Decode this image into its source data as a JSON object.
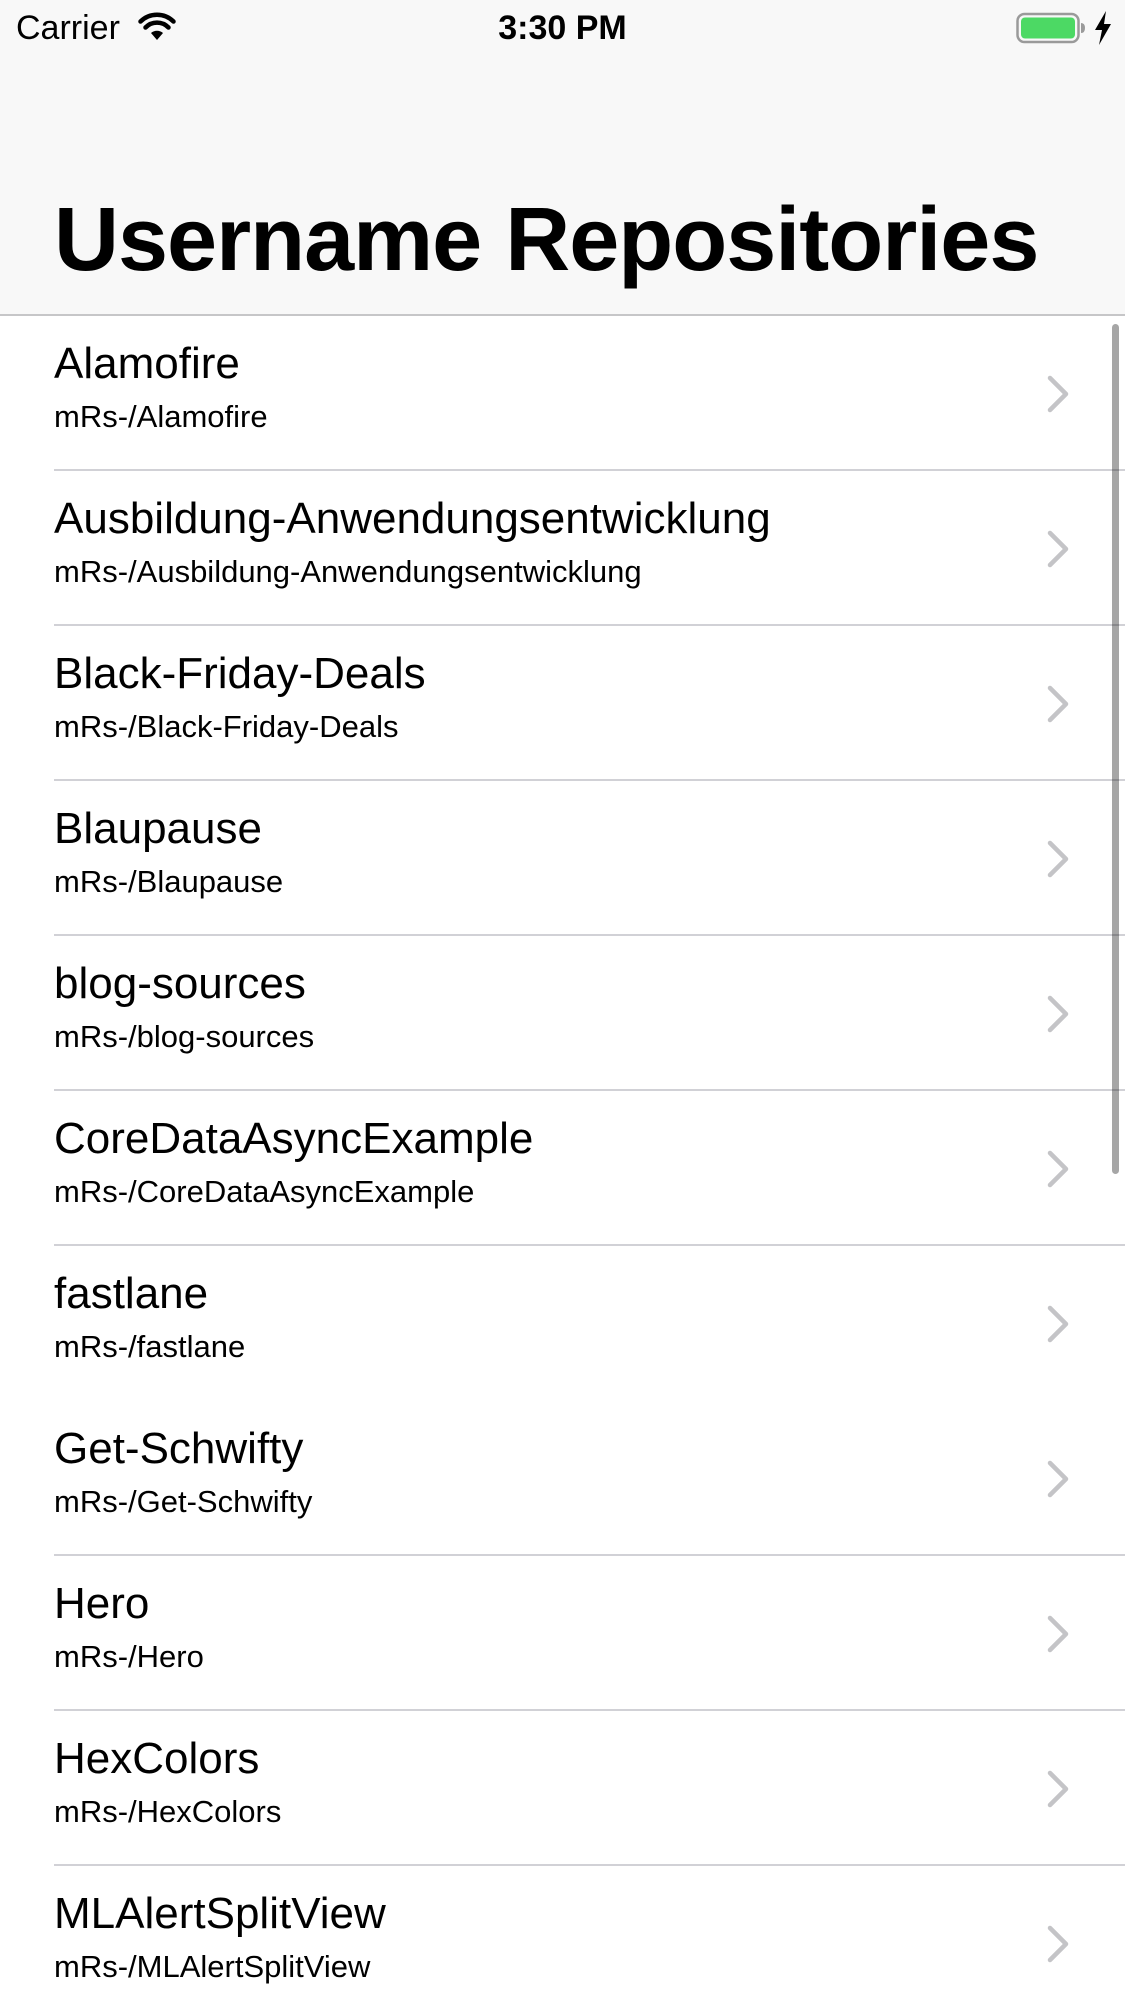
{
  "status_bar": {
    "carrier": "Carrier",
    "time": "3:30 PM",
    "icons": [
      "wifi-icon",
      "battery-icon",
      "charging-icon"
    ],
    "battery_color": "#4cd964"
  },
  "nav": {
    "title": "Username Repositories"
  },
  "repos": [
    {
      "name": "Alamofire",
      "full_name": "mRs-/Alamofire"
    },
    {
      "name": "Ausbildung-Anwendungsentwicklung",
      "full_name": "mRs-/Ausbildung-Anwendungsentwicklung"
    },
    {
      "name": "Black-Friday-Deals",
      "full_name": "mRs-/Black-Friday-Deals"
    },
    {
      "name": "Blaupause",
      "full_name": "mRs-/Blaupause"
    },
    {
      "name": "blog-sources",
      "full_name": "mRs-/blog-sources"
    },
    {
      "name": "CoreDataAsyncExample",
      "full_name": "mRs-/CoreDataAsyncExample"
    },
    {
      "name": "fastlane",
      "full_name": "mRs-/fastlane"
    },
    {
      "name": "Get-Schwifty",
      "full_name": "mRs-/Get-Schwifty"
    },
    {
      "name": "Hero",
      "full_name": "mRs-/Hero"
    },
    {
      "name": "HexColors",
      "full_name": "mRs-/HexColors"
    },
    {
      "name": "MLAlertSplitView",
      "full_name": "mRs-/MLAlertSplitView"
    }
  ]
}
